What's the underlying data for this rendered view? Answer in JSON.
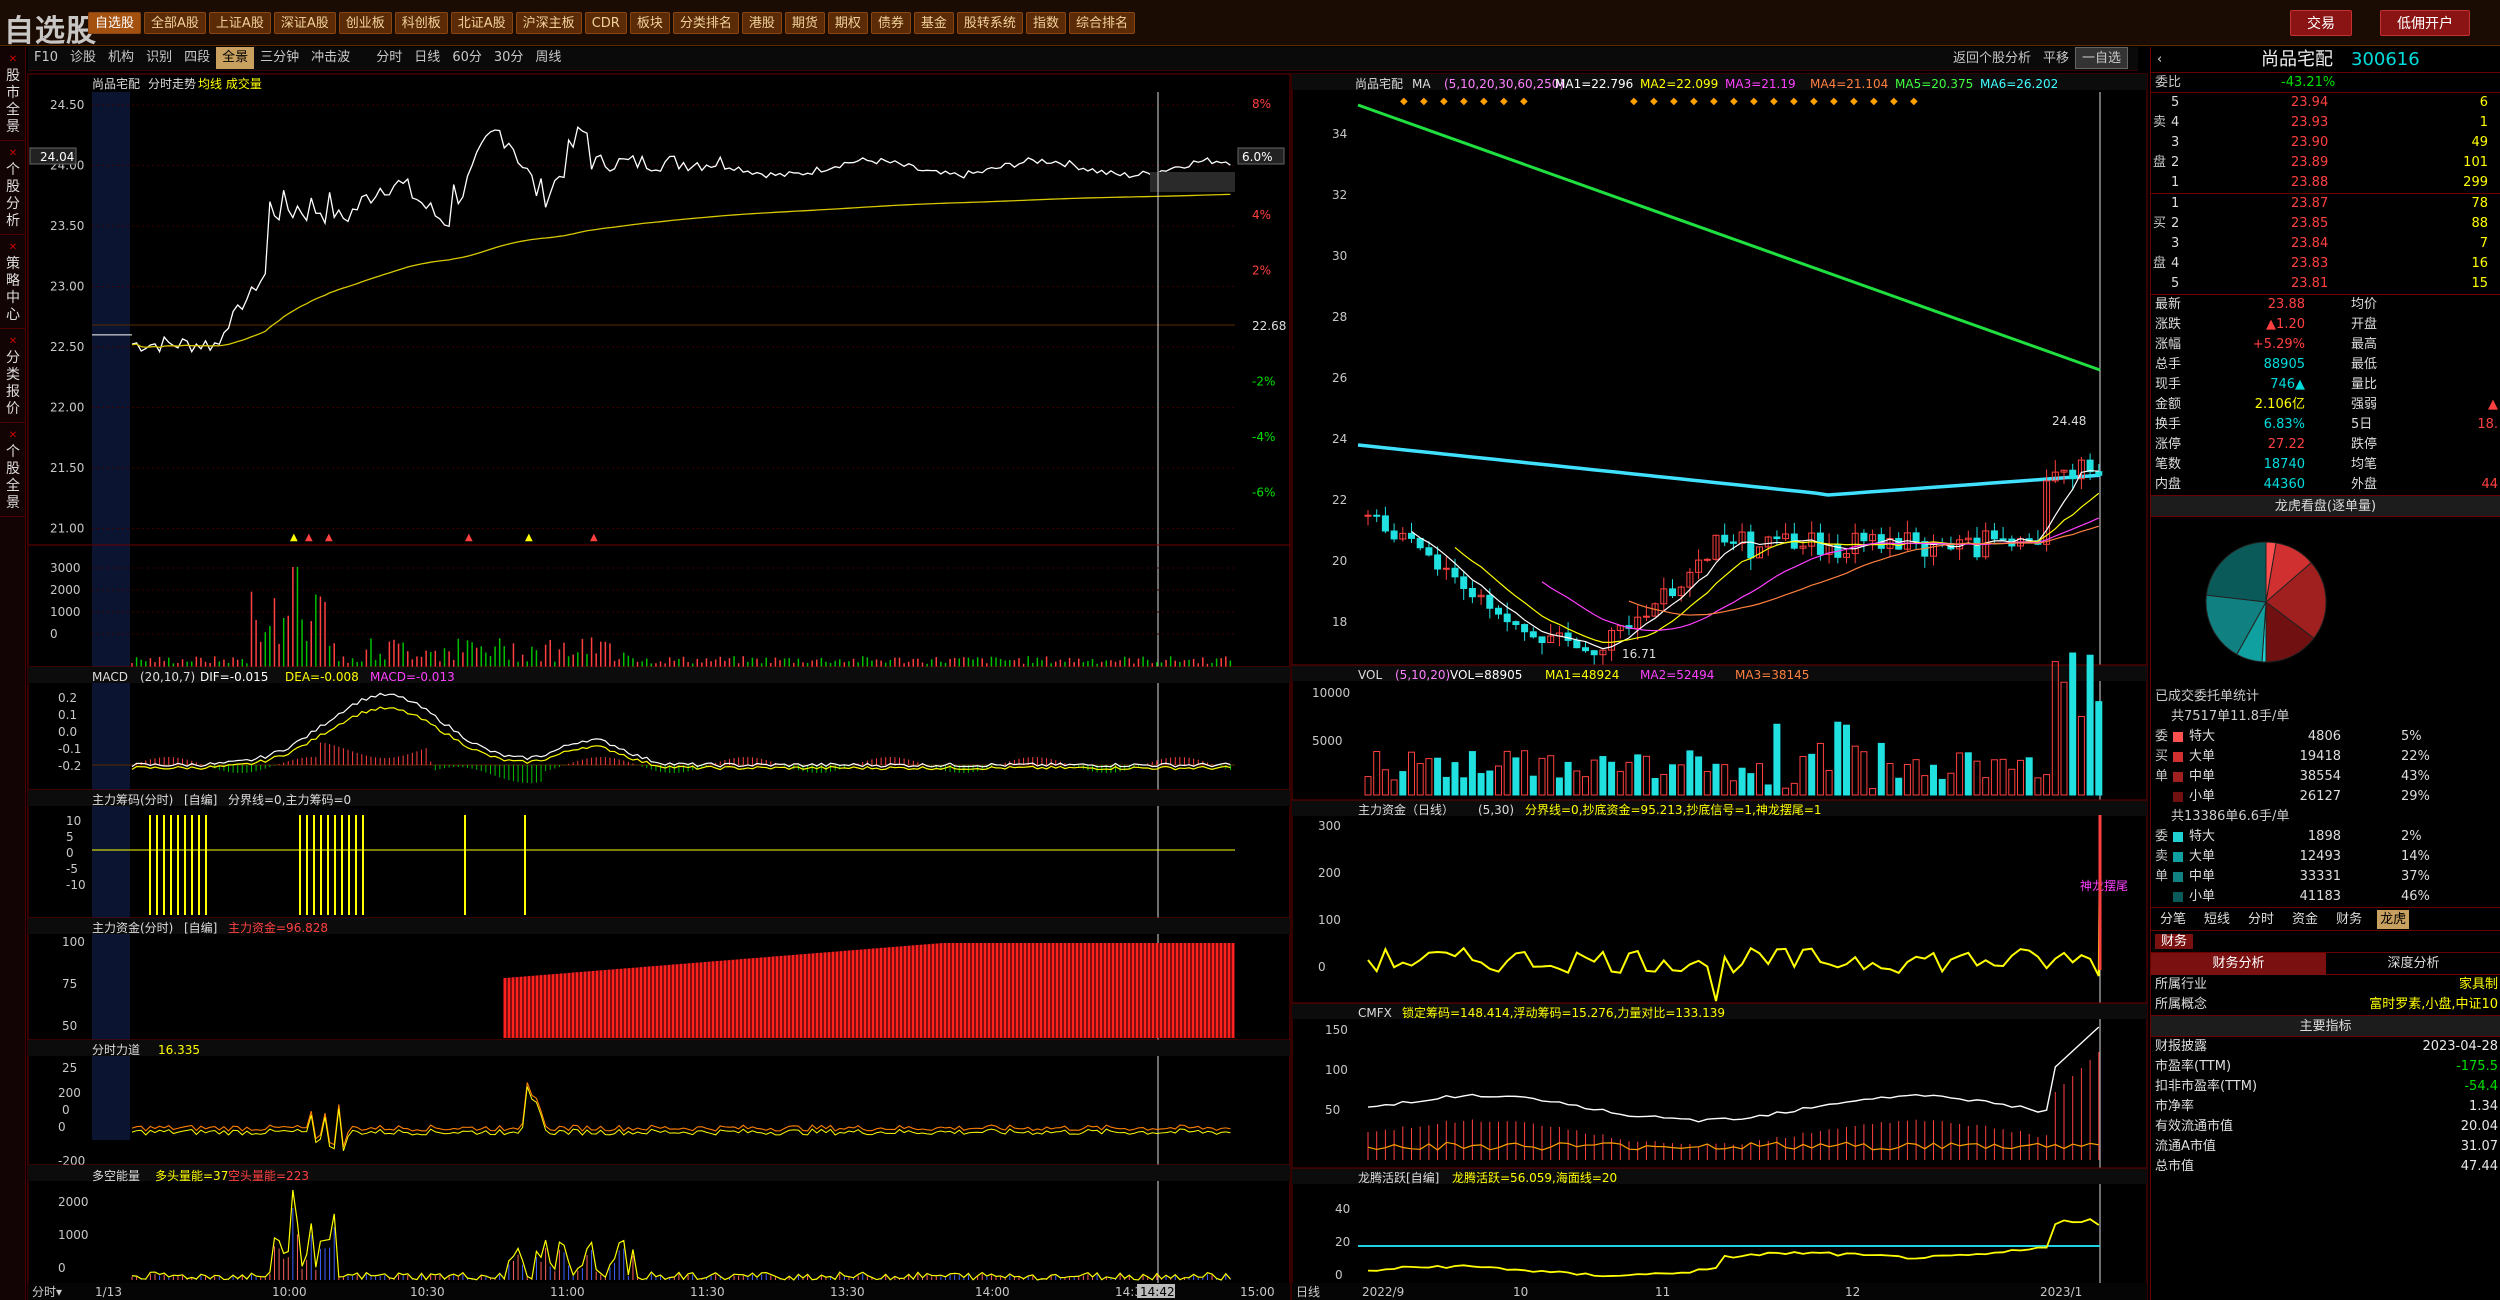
{
  "topbar": {
    "logo": "自选股",
    "categories": [
      "自选股",
      "全部A股",
      "上证A股",
      "深证A股",
      "创业板",
      "科创板",
      "北证A股",
      "沪深主板",
      "CDR",
      "板块",
      "分类排名",
      "港股",
      "期货",
      "期权",
      "债券",
      "基金",
      "股转系统",
      "指数",
      "综合排名"
    ],
    "trade": "交易",
    "margin": "低佣开户"
  },
  "toolbar": {
    "items": [
      "F10",
      "诊股",
      "机构",
      "识别",
      "四段",
      "全景",
      "三分钟",
      "冲击波"
    ],
    "active": "全景",
    "periods": [
      "分时",
      "日线",
      "60分",
      "30分",
      "周线"
    ],
    "right": [
      "返回个股分析",
      "平移",
      "一自选"
    ]
  },
  "leftnav": [
    {
      "label": "股市全景"
    },
    {
      "label": "个股分析"
    },
    {
      "label": "策略中心"
    },
    {
      "label": "分类报价"
    },
    {
      "label": "个股全景"
    }
  ],
  "colors": {
    "up": "#ff4040",
    "down": "#00e000",
    "accent": "#c8a060",
    "border": "#6b0000"
  },
  "intraday": {
    "title": "尚品宅配",
    "subtitle": "分时走势",
    "legend": "均线 成交量",
    "price_ticks": [
      "24.50",
      "24.00",
      "23.50",
      "23.00",
      "22.50",
      "22.00",
      "21.50",
      "21.00"
    ],
    "pct_ticks": [
      "8%",
      "6%",
      "4%",
      "2%",
      "22.68",
      "-2%",
      "-4%",
      "-6%"
    ],
    "current_tag": "24.04",
    "pct_tag": "6.0%",
    "vol_ticks": [
      "3000",
      "2000",
      "1000",
      "0"
    ],
    "time_labels": [
      "1/13",
      "10:00",
      "10:30",
      "11:00",
      "11:30",
      "13:30",
      "14:00",
      "14:30",
      "14:42",
      "15:00"
    ],
    "cursor_time": "14:42"
  },
  "macd_intraday": {
    "title": "MACD",
    "params": "(20,10,7)",
    "dif": "DIF=-0.015",
    "dea": "DEA=-0.008",
    "macd": "MACD=-0.013",
    "ticks": [
      "0.2",
      "0.1",
      "0.0",
      "-0.1",
      "-0.2"
    ]
  },
  "zljc": {
    "title": "主力筹码(分时)",
    "mode": "[自编]",
    "text": "分界线=0,主力筹码=0",
    "ticks": [
      "10",
      "5",
      "0",
      "-5",
      "-10"
    ]
  },
  "zlzj": {
    "title": "主力资金(分时)",
    "mode": "[自编]",
    "text": "主力资金=96.828",
    "ticks": [
      "100",
      "75",
      "50",
      "25",
      "0"
    ]
  },
  "fsld": {
    "title": "分时力道",
    "value": "16.335",
    "ticks": [
      "200",
      "0",
      "-200"
    ]
  },
  "dkn": {
    "title": "多空能量",
    "text1": "多头量能=37",
    "text2": "空头量能=223",
    "ticks": [
      "2000",
      "1000",
      "0"
    ]
  },
  "daily": {
    "title": "尚品宅配",
    "ma_label": "MA",
    "ma_params": "(5,10,20,30,60,250)",
    "ma_values": [
      "MA1=22.796",
      "MA2=22.099",
      "MA3=21.19",
      "MA4=21.104",
      "MA5=20.375",
      "MA6=26.202"
    ],
    "ticks": [
      "34",
      "32",
      "30",
      "28",
      "26",
      "24",
      "22",
      "20",
      "18"
    ],
    "high_label": "24.48",
    "low_label": "16.71",
    "date_labels": [
      "2022/9",
      "10",
      "11",
      "12",
      "2023/1"
    ],
    "bottom_tag": "日线"
  },
  "vol": {
    "title": "VOL",
    "params": "(5,10,20)",
    "values": [
      "VOL=88905",
      "MA1=48924",
      "MA2=52494",
      "MA3=38145"
    ],
    "ticks": [
      "10000",
      "5000"
    ]
  },
  "zlzj_day": {
    "title": "主力资金（日线）",
    "params": "(5,30)",
    "text": "分界线=0,抄底资金=95.213,抄底信号=1,神龙摆尾=1",
    "ticks": [
      "300",
      "200",
      "100",
      "0"
    ],
    "tag": "神龙摆尾"
  },
  "cmfx": {
    "title": "CMFX",
    "text": "锁定筹码=148.414,浮动筹码=15.276,力量对比=133.139",
    "ticks": [
      "150",
      "100",
      "50"
    ]
  },
  "lths": {
    "title": "龙腾活跃[自编]",
    "text": "龙腾活跃=56.059,海面线=20",
    "ticks": [
      "40",
      "20",
      "0"
    ]
  },
  "quote": {
    "name": "尚品宅配",
    "code": "300616",
    "webi_label": "委比",
    "webi": "-43.21%",
    "asks": [
      {
        "l": "5",
        "p": "23.94",
        "v": "6"
      },
      {
        "l": "4",
        "p": "23.93",
        "v": "1"
      },
      {
        "l": "3",
        "p": "23.90",
        "v": "49"
      },
      {
        "l": "2",
        "p": "23.89",
        "v": "101"
      },
      {
        "l": "1",
        "p": "23.88",
        "v": "299"
      }
    ],
    "bids": [
      {
        "l": "1",
        "p": "23.87",
        "v": "78"
      },
      {
        "l": "2",
        "p": "23.85",
        "v": "88"
      },
      {
        "l": "3",
        "p": "23.84",
        "v": "7"
      },
      {
        "l": "4",
        "p": "23.83",
        "v": "16"
      },
      {
        "l": "5",
        "p": "23.81",
        "v": "15"
      }
    ],
    "sell_label": "卖",
    "buy_label": "买",
    "pan_label": "盘",
    "stats": [
      [
        "最新",
        "23.88",
        "均价",
        ""
      ],
      [
        "涨跌",
        "▲1.20",
        "开盘",
        ""
      ],
      [
        "涨幅",
        "+5.29%",
        "最高",
        ""
      ],
      [
        "总手",
        "88905",
        "最低",
        ""
      ],
      [
        "现手",
        "746▲",
        "量比",
        ""
      ],
      [
        "金额",
        "2.106亿",
        "强弱",
        "▲"
      ],
      [
        "换手",
        "6.83%",
        "5日",
        "18."
      ],
      [
        "涨停",
        "27.22",
        "跌停",
        ""
      ],
      [
        "笔数",
        "18740",
        "均笔",
        ""
      ],
      [
        "内盘",
        "44360",
        "外盘",
        "44"
      ]
    ]
  },
  "lhb": {
    "title": "龙虎看盘(逐单量)",
    "done_title": "已成交委托单统计",
    "buy_summary": "共7517单11.8手/单",
    "buy": [
      {
        "n": "特大",
        "v": "4806",
        "p": "5%"
      },
      {
        "n": "大单",
        "v": "19418",
        "p": "22%"
      },
      {
        "n": "中单",
        "v": "38554",
        "p": "43%"
      },
      {
        "n": "小单",
        "v": "26127",
        "p": "29%"
      }
    ],
    "sell_summary": "共13386单6.6手/单",
    "sell": [
      {
        "n": "特大",
        "v": "1898",
        "p": "2%"
      },
      {
        "n": "大单",
        "v": "12493",
        "p": "14%"
      },
      {
        "n": "中单",
        "v": "33331",
        "p": "37%"
      },
      {
        "n": "小单",
        "v": "41183",
        "p": "46%"
      }
    ],
    "side_buy": [
      "委",
      "买",
      "单"
    ],
    "side_sell": [
      "委",
      "卖",
      "单"
    ],
    "tabs": [
      "分笔",
      "短线",
      "分时",
      "资金",
      "财务",
      "龙虎"
    ]
  },
  "fin": {
    "tab": "财务",
    "analysis": "财务分析",
    "deep": "深度分析",
    "rows": [
      [
        "所属行业",
        "家具制"
      ],
      [
        "所属概念",
        "富时罗素,小盘,中证10"
      ]
    ],
    "main_title": "主要指标",
    "indicators": [
      [
        "财报披露",
        "2023-04-28"
      ],
      [
        "市盈率(TTM)",
        "-175.5"
      ],
      [
        "扣非市盈率(TTM)",
        "-54.4"
      ],
      [
        "市净率",
        "1.34"
      ],
      [
        "有效流通市值",
        "20.04"
      ],
      [
        "流通A市值",
        "31.07"
      ],
      [
        "总市值",
        "47.44"
      ]
    ]
  }
}
